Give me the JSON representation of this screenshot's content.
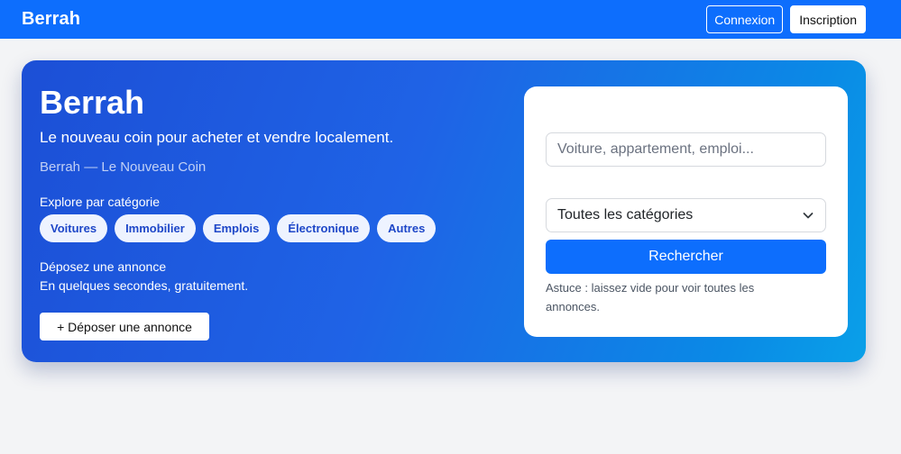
{
  "navbar": {
    "brand": "Berrah",
    "login_label": "Connexion",
    "signup_label": "Inscription"
  },
  "hero": {
    "title": "Berrah",
    "tagline": "Le nouveau coin pour acheter et vendre localement.",
    "subtitle": "Berrah — Le Nouveau Coin",
    "explore_label": "Explore par catégorie",
    "categories": [
      "Voitures",
      "Immobilier",
      "Emplois",
      "Électronique",
      "Autres"
    ],
    "deposit_title": "Déposez une annonce",
    "deposit_subtitle": "En quelques secondes, gratuitement.",
    "deposit_button": "+ Déposer une annonce"
  },
  "search": {
    "input_placeholder": "Voiture, appartement, emploi...",
    "input_value": "",
    "category_selected": "Toutes les catégories",
    "submit_label": "Rechercher",
    "tip": "Astuce : laissez vide pour voir toutes les annonces."
  },
  "colors": {
    "primary": "#0d6efd",
    "hero_gradient_start": "#1c4fd6",
    "hero_gradient_end": "#0aa0e8",
    "chip_bg": "#eef3ff",
    "chip_text": "#1e47c8",
    "page_bg": "#f3f4f6"
  },
  "icons": {
    "select_caret": "chevron-down-icon"
  }
}
